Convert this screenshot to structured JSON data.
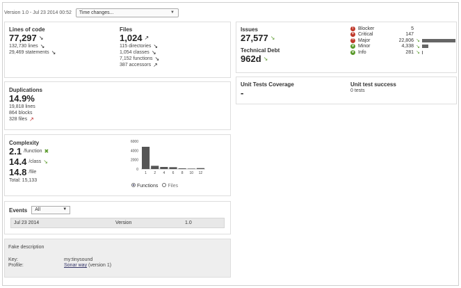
{
  "header": {
    "version": "Version 1.0 - Jul 23 2014 00:52",
    "time_changes": "Time changes..."
  },
  "size": {
    "lines_of_code_label": "Lines of code",
    "lines_of_code": "77,297",
    "lines": "132,730 lines",
    "statements": "29,469 statements",
    "files_label": "Files",
    "files": "1,024",
    "directories": "115 directories",
    "classes": "1,054 classes",
    "functions": "7,152 functions",
    "accessors": "387 accessors"
  },
  "duplications": {
    "label": "Duplications",
    "percent": "14.9%",
    "lines": "19,818 lines",
    "blocks": "864 blocks",
    "files": "328 files"
  },
  "complexity": {
    "label": "Complexity",
    "per_function": "2.1",
    "per_function_unit": "/function",
    "per_class": "14.4",
    "per_class_unit": "/class",
    "per_file": "14.8",
    "per_file_unit": "/file",
    "total": "Total: 15,133",
    "option_functions": "Functions",
    "option_files": "Files"
  },
  "chart_data": {
    "type": "bar",
    "categories": [
      "1",
      "2",
      "4",
      "6",
      "8",
      "10",
      "12"
    ],
    "values": [
      4800,
      700,
      450,
      400,
      150,
      100,
      200
    ],
    "ylim": [
      0,
      6000
    ],
    "yticks": [
      "6000",
      "4000",
      "2000",
      "0"
    ],
    "xlabel": "",
    "ylabel": "",
    "title": ""
  },
  "events": {
    "label": "Events",
    "filter": "All",
    "rows": [
      {
        "date": "Jul 23 2014",
        "type": "Version",
        "name": "1.0"
      }
    ]
  },
  "description": {
    "text": "Fake description",
    "key_label": "Key:",
    "key": "my:tinysound",
    "profile_label": "Profile:",
    "profile": "Sonar way",
    "profile_version": "(version 1)"
  },
  "issues": {
    "label": "Issues",
    "value": "27,577",
    "tech_debt_label": "Technical Debt",
    "tech_debt": "962d",
    "severities": [
      {
        "name": "Blocker",
        "count": "5",
        "color": "#c0392b",
        "symbol": "!",
        "bar": 0
      },
      {
        "name": "Critical",
        "count": "147",
        "color": "#c0392b",
        "symbol": "+",
        "bar": 0
      },
      {
        "name": "Major",
        "count": "22,806",
        "color": "#c0392b",
        "symbol": "^",
        "bar": 0.82
      },
      {
        "name": "Minor",
        "count": "4,338",
        "color": "#5a9a2b",
        "symbol": "v",
        "bar": 0.16
      },
      {
        "name": "Info",
        "count": "281",
        "color": "#5a9a2b",
        "symbol": "v",
        "bar": 0.01
      }
    ]
  },
  "tests": {
    "coverage_label": "Unit Tests Coverage",
    "coverage_value": "-",
    "success_label": "Unit test success",
    "success_value": "0 tests"
  }
}
